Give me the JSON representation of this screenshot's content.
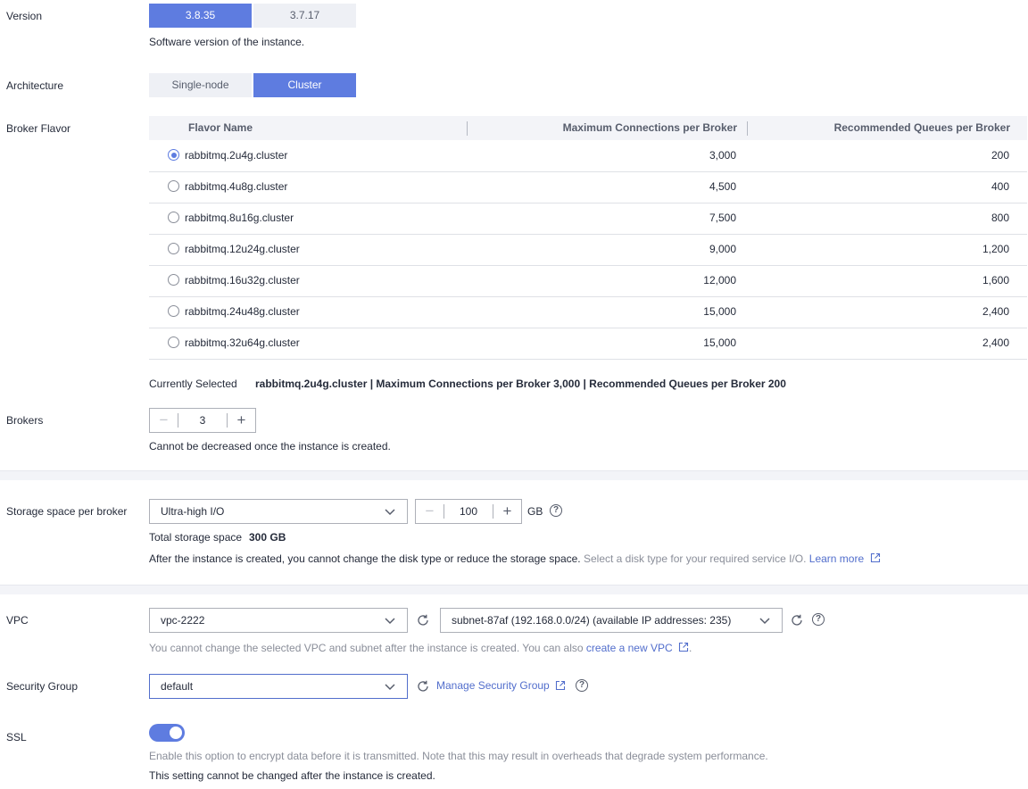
{
  "version": {
    "label": "Version",
    "options": [
      "3.8.35",
      "3.7.17"
    ],
    "selected": "3.8.35",
    "hint": "Software version of the instance."
  },
  "architecture": {
    "label": "Architecture",
    "options": [
      "Single-node",
      "Cluster"
    ],
    "selected": "Cluster"
  },
  "broker_flavor": {
    "label": "Broker Flavor",
    "columns": [
      "Flavor Name",
      "Maximum Connections per Broker",
      "Recommended Queues per Broker"
    ],
    "rows": [
      {
        "name": "rabbitmq.2u4g.cluster",
        "max_conn": "3,000",
        "queues": "200",
        "selected": true
      },
      {
        "name": "rabbitmq.4u8g.cluster",
        "max_conn": "4,500",
        "queues": "400",
        "selected": false
      },
      {
        "name": "rabbitmq.8u16g.cluster",
        "max_conn": "7,500",
        "queues": "800",
        "selected": false
      },
      {
        "name": "rabbitmq.12u24g.cluster",
        "max_conn": "9,000",
        "queues": "1,200",
        "selected": false
      },
      {
        "name": "rabbitmq.16u32g.cluster",
        "max_conn": "12,000",
        "queues": "1,600",
        "selected": false
      },
      {
        "name": "rabbitmq.24u48g.cluster",
        "max_conn": "15,000",
        "queues": "2,400",
        "selected": false
      },
      {
        "name": "rabbitmq.32u64g.cluster",
        "max_conn": "15,000",
        "queues": "2,400",
        "selected": false
      }
    ],
    "current_label": "Currently Selected",
    "current_value": "rabbitmq.2u4g.cluster | Maximum Connections per Broker 3,000 | Recommended Queues per Broker 200"
  },
  "brokers": {
    "label": "Brokers",
    "value": "3",
    "minus": "−",
    "plus": "+",
    "hint": "Cannot be decreased once the instance is created."
  },
  "storage": {
    "label": "Storage space per broker",
    "disk_type": "Ultra-high I/O",
    "size": "100",
    "unit": "GB",
    "total_label": "Total storage space",
    "total_value": "300 GB",
    "note": "After the instance is created, you cannot change the disk type or reduce the storage space.",
    "note_grey": "Select a disk type for your required service I/O.",
    "learn_more": "Learn more"
  },
  "vpc": {
    "label": "VPC",
    "value": "vpc-2222",
    "subnet": "subnet-87af (192.168.0.0/24) (available IP addresses: 235)",
    "hint": "You cannot change the selected VPC and subnet after the instance is created. You can also",
    "create_link": "create a new VPC",
    "hint_end": "."
  },
  "security_group": {
    "label": "Security Group",
    "value": "default",
    "manage_link": "Manage Security Group"
  },
  "ssl": {
    "label": "SSL",
    "enabled": true,
    "hint1": "Enable this option to encrypt data before it is transmitted. Note that this may result in overheads that degrade system performance.",
    "hint2": "This setting cannot be changed after the instance is created."
  },
  "icons": {
    "refresh": "refresh-icon",
    "help": "question-icon",
    "external": "external-link-icon",
    "chevron": "chevron-down-icon"
  },
  "colors": {
    "accent": "#5e7ce0",
    "link": "#526ecc"
  }
}
